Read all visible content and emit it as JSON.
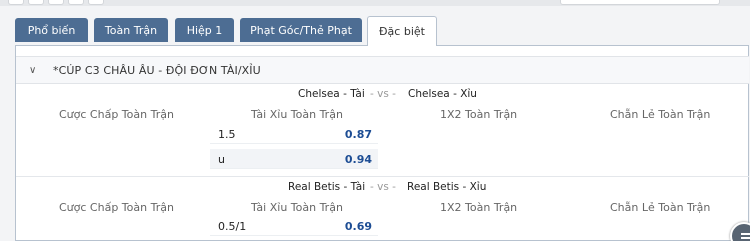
{
  "tabs": [
    {
      "label": "Phổ biến",
      "active": false
    },
    {
      "label": "Toàn Trận",
      "active": false
    },
    {
      "label": "Hiệp 1",
      "active": false
    },
    {
      "label": "Phạt Góc/Thẻ Phạt",
      "active": false
    },
    {
      "label": "Đặc biệt",
      "active": true
    }
  ],
  "section": {
    "title": "*CÚP C3 CHÂU ÂU - ĐỘI ĐƠN TÀI/XỈU",
    "toggle_icon": "chevron-down-icon"
  },
  "columns": {
    "handicap": "Cược Chấp Toàn Trận",
    "over_under": "Tài Xỉu Toàn Trận",
    "one_x_two": "1X2 Toàn Trận",
    "odd_even": "Chẵn Lẻ Toàn Trận"
  },
  "matches": [
    {
      "home": "Chelsea - Tài",
      "vs": "- vs -",
      "away": "Chelsea - Xỉu",
      "over_under": [
        {
          "line": "1.5",
          "odds": "0.87"
        },
        {
          "line": "u",
          "odds": "0.94"
        }
      ]
    },
    {
      "home": "Real Betis - Tài",
      "vs": "- vs -",
      "away": "Real Betis - Xỉu",
      "over_under": [
        {
          "line": "0.5/1",
          "odds": "0.69"
        }
      ]
    }
  ],
  "colors": {
    "tab_bg": "#4d6d93",
    "odds_text": "#1d4d94"
  }
}
